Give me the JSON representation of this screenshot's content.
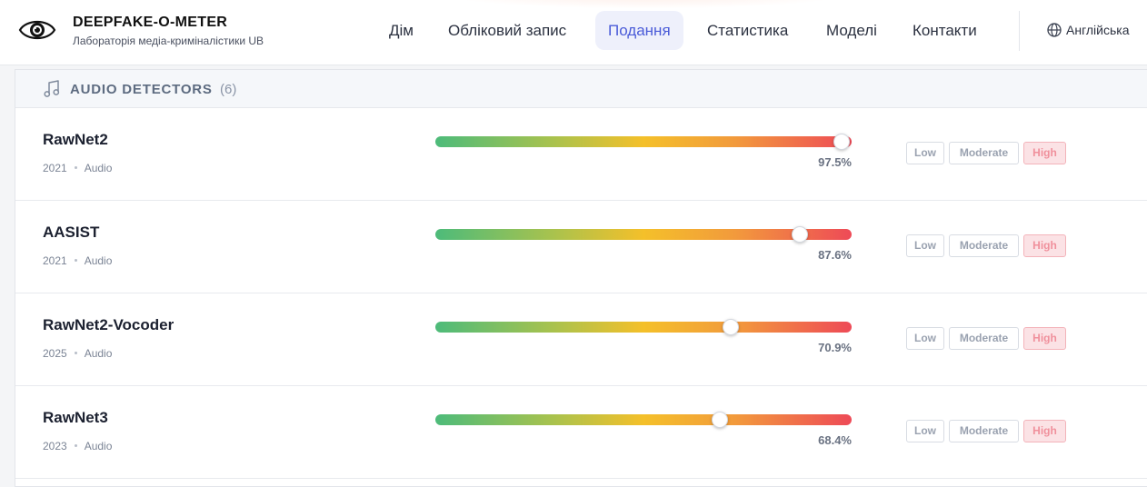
{
  "brand": {
    "title": "DEEPFAKE-O-METER",
    "subtitle": "Лабораторія медіа-криміналістики UB"
  },
  "nav": {
    "items": [
      {
        "label": "Дім",
        "active": false
      },
      {
        "label": "Обліковий запис",
        "active": false
      },
      {
        "label": "Подання",
        "active": true
      },
      {
        "label": "Статистика",
        "active": false
      },
      {
        "label": "Моделі",
        "active": false
      },
      {
        "label": "Контакти",
        "active": false
      }
    ],
    "language": "Англійська"
  },
  "section": {
    "title": "AUDIO DETECTORS",
    "count": "(6)"
  },
  "chips": {
    "low": "Low",
    "moderate": "Moderate",
    "high": "High"
  },
  "detectors": [
    {
      "name": "RawNet2",
      "year": "2021",
      "type": "Audio",
      "score": 97.5,
      "score_label": "97.5%"
    },
    {
      "name": "AASIST",
      "year": "2021",
      "type": "Audio",
      "score": 87.6,
      "score_label": "87.6%"
    },
    {
      "name": "RawNet2-Vocoder",
      "year": "2025",
      "type": "Audio",
      "score": 70.9,
      "score_label": "70.9%"
    },
    {
      "name": "RawNet3",
      "year": "2023",
      "type": "Audio",
      "score": 68.4,
      "score_label": "68.4%"
    }
  ],
  "colors": {
    "accent": "#4a5bd8",
    "high_chip_bg": "#fbe2e5",
    "gradient_start": "#4dbb7a",
    "gradient_mid": "#f4c02a",
    "gradient_end": "#ee4a57"
  }
}
